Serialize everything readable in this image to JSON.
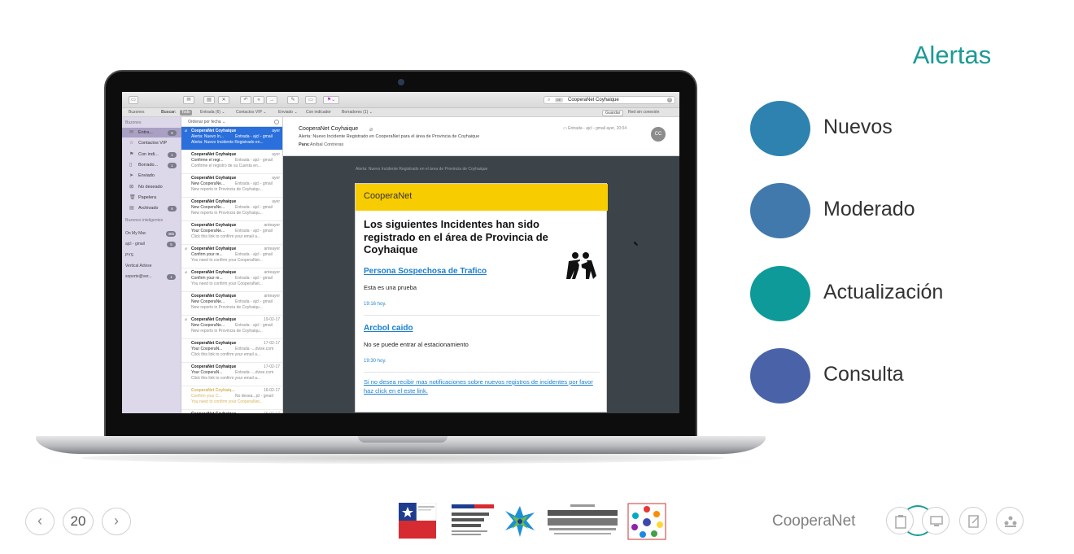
{
  "slide": {
    "title": "Alertas",
    "brand": "CooperaNet",
    "page_number": "20"
  },
  "legend": [
    {
      "label": "Nuevos",
      "color": "#2d82b0"
    },
    {
      "label": "Moderado",
      "color": "#4179ad"
    },
    {
      "label": "Actualización",
      "color": "#0d9a98"
    },
    {
      "label": "Consulta",
      "color": "#4a63a8"
    }
  ],
  "mail": {
    "search_chip": "DE",
    "search_text": "CooperaNet Coyhaique",
    "favbar": {
      "mailboxes": "Buzones",
      "search_label": "Buscar:",
      "all": "Todo",
      "inbox": "Entrada (6) ⌄",
      "vip": "Contactos VIP ⌄",
      "sent": "Enviado ⌄",
      "flagged": "Con indicador",
      "drafts": "Borradores (1) ⌄",
      "save": "Guardar",
      "offline": "Red sin conexión"
    },
    "sidebar": {
      "header": "Buzones",
      "items": [
        {
          "label": "Entra...",
          "badge": "6",
          "icon": "inbox-icon",
          "glyph": "✉"
        },
        {
          "label": "Contactos VIP",
          "badge": "",
          "icon": "star-icon",
          "glyph": "☆"
        },
        {
          "label": "Con indi...",
          "badge": "1",
          "icon": "flag-icon",
          "glyph": "⚑"
        },
        {
          "label": "Borrado...",
          "badge": "1",
          "icon": "draft-icon",
          "glyph": "▯"
        },
        {
          "label": "Enviado",
          "badge": "",
          "icon": "sent-icon",
          "glyph": "➤"
        },
        {
          "label": "No deseado",
          "badge": "",
          "icon": "junk-icon",
          "glyph": "⊠"
        },
        {
          "label": "Papelera",
          "badge": "",
          "icon": "trash-icon",
          "glyph": "🗑"
        },
        {
          "label": "Archivado",
          "badge": "6",
          "icon": "archive-icon",
          "glyph": "▤"
        }
      ],
      "smart_header": "Buzones inteligentes",
      "accounts": [
        {
          "label": "On My Mac",
          "badge": "385"
        },
        {
          "label": "ajcl - gmail",
          "badge": "5"
        },
        {
          "label": "PYS",
          "badge": ""
        },
        {
          "label": "Vertical Advise",
          "badge": ""
        },
        {
          "label": "soporte@ver...",
          "badge": "1"
        }
      ]
    },
    "list": {
      "sort_label": "Ordenar por fecha ⌄",
      "messages": [
        {
          "from": "CooperaNet Coyhaique",
          "date": "ayer",
          "subject": "Alerta: Nuevo In...",
          "mailbox": "Entrada - ajcl - gmail",
          "preview": "Alerta: Nuevo Incidente Registrado en...",
          "clip": "⌀"
        },
        {
          "from": "CooperaNet Coyhaique",
          "date": "ayer",
          "subject": "Confirme el regi...",
          "mailbox": "Entrada - ajcl - gmail",
          "preview": "Confirme el registro de su Cuenta en...",
          "clip": ""
        },
        {
          "from": "CooperaNet Coyhaique",
          "date": "ayer",
          "subject": "New CooperaNe...",
          "mailbox": "Entrada - ajcl - gmail",
          "preview": "New reports in Provincia de Coyhaiqu...",
          "clip": ""
        },
        {
          "from": "CooperaNet Coyhaique",
          "date": "ayer",
          "subject": "New CooperaNe...",
          "mailbox": "Entrada - ajcl - gmail",
          "preview": "New reports in Provincia de Coyhaiqu...",
          "clip": ""
        },
        {
          "from": "CooperaNet Coyhaique",
          "date": "anteayer",
          "subject": "Your CooperaNe...",
          "mailbox": "Entrada - ajcl - gmail",
          "preview": "Click this link to confirm your email a...",
          "clip": ""
        },
        {
          "from": "CooperaNet Coyhaique",
          "date": "anteayer",
          "subject": "Confirm your re...",
          "mailbox": "Entrada - ajcl - gmail",
          "preview": "You need to confirm your CooperaNet...",
          "clip": "⌀"
        },
        {
          "from": "CooperaNet Coyhaique",
          "date": "anteayer",
          "subject": "Confirm your re...",
          "mailbox": "Entrada - ajcl - gmail",
          "preview": "You need to confirm your CooperaNet...",
          "clip": "⌀"
        },
        {
          "from": "CooperaNet Coyhaique",
          "date": "anteayer",
          "subject": "New CooperaNe...",
          "mailbox": "Entrada - ajcl - gmail",
          "preview": "New reports in Provincia de Coyhaiqu...",
          "clip": ""
        },
        {
          "from": "CooperaNet Coyhaique",
          "date": "19-02-17",
          "subject": "New CooperaNe...",
          "mailbox": "Entrada - ajcl - gmail",
          "preview": "New reports in Provincia de Coyhaiqu...",
          "clip": "⌀"
        },
        {
          "from": "CooperaNet Coyhaique",
          "date": "17-02-17",
          "subject": "Your CooperaN...",
          "mailbox": "Entrada -...dvise.com",
          "preview": "Click this link to confirm your email a...",
          "clip": ""
        },
        {
          "from": "CooperaNet Coyhaique",
          "date": "17-02-17",
          "subject": "Your CooperaN...",
          "mailbox": "Entrada -...dvise.com",
          "preview": "Click this link to confirm your email a...",
          "clip": ""
        },
        {
          "from": "CooperaNet Coyhaiq...",
          "date": "16-02-17",
          "subject": "Confirm your C...",
          "mailbox": "No desea...jcl - gmail",
          "preview": "You need to confirm your CooperaNet...",
          "clip": ""
        },
        {
          "from": "CooperaNet Coyhaique",
          "date": "16-02-17",
          "subject": "",
          "mailbox": "",
          "preview": "",
          "clip": ""
        }
      ]
    },
    "reader": {
      "from": "CooperaNet Coyhaique",
      "subject": "Alerta: Nuevo Incidente Registrado en CooperaNet para el área de Provincia de Coyhaique",
      "to_label": "Para:",
      "to": "Aníbal Contreras",
      "meta": "▭ Entrada - ajcl - gmail      ayer, 20:04",
      "avatar": "CC",
      "preheader": "Alerta: Nuevo Incidente Registrado en el área de Provincia de Coyhaique",
      "card_brand": "CooperaNet",
      "headline": "Los siguientes Incidentes han sido registrado en el área de Provincia de Coyhaique",
      "incidents": [
        {
          "title": "Persona Sospechosa de Trafico",
          "desc": "Esta es una prueba",
          "time": "19:16 hoy."
        },
        {
          "title": "Arcbol caido",
          "desc": "No se puede entrar al estacionamiento",
          "time": "19:30 hoy."
        }
      ],
      "unsubscribe": "Si no desea recibir mas notificaciones sobre nuevos registros de incidentes por favor haz click en el este link."
    }
  }
}
